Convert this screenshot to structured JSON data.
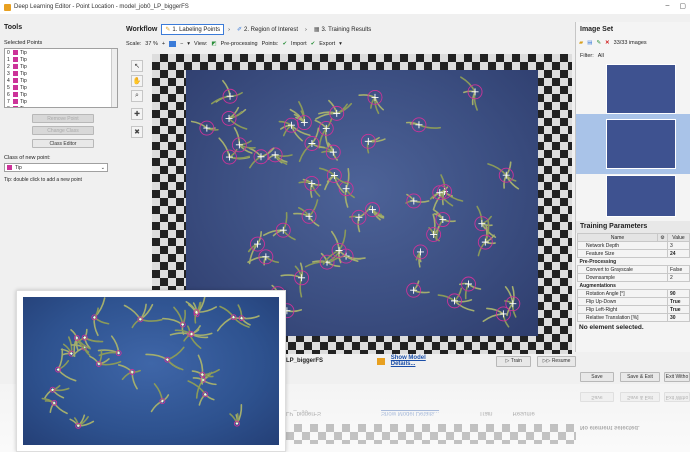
{
  "window": {
    "title": "Deep Learning Editor - Point Location - model_job0_LP_biggerFS",
    "minimize": "–",
    "maximize": "▢"
  },
  "tools": {
    "header": "Tools",
    "selected_points_label": "Selected Points",
    "points": [
      {
        "index": "0",
        "label": "Tip"
      },
      {
        "index": "1",
        "label": "Tip"
      },
      {
        "index": "2",
        "label": "Tip"
      },
      {
        "index": "3",
        "label": "Tip"
      },
      {
        "index": "4",
        "label": "Tip"
      },
      {
        "index": "5",
        "label": "Tip"
      },
      {
        "index": "6",
        "label": "Tip"
      },
      {
        "index": "7",
        "label": "Tip"
      },
      {
        "index": "8",
        "label": "Tip"
      }
    ],
    "remove_point": "Remove Point",
    "change_class": "Change Class",
    "class_editor": "Class Editor",
    "class_of_new_point_label": "Class of new point:",
    "class_selected": "Tip",
    "hint": "Tip: double click to add a new point"
  },
  "workflow": {
    "label": "Workflow",
    "steps": [
      {
        "label": "1. Labeling Points",
        "active": true
      },
      {
        "label": "2. Region of Interest",
        "active": false
      },
      {
        "label": "3. Training Results",
        "active": false
      }
    ]
  },
  "viewbar": {
    "scale_label": "Scale:",
    "scale_value": "37 %",
    "view_label": "View:",
    "view_value": "Pre-processing",
    "points_label": "Points:",
    "import_label": "Import",
    "export_label": "Export"
  },
  "image_set": {
    "header": "Image Set",
    "count": "33/33 images",
    "filter_label": "Filter:",
    "filter_value": "All"
  },
  "training": {
    "header": "Training Parameters",
    "col_name": "Name",
    "col_value": "Value",
    "rows": [
      {
        "name": "Network Depth",
        "value": "3",
        "bold": false
      },
      {
        "name": "Feature Size",
        "value": "24",
        "bold": true
      }
    ],
    "preproc_header": "Pre-Processing",
    "preproc_rows": [
      {
        "name": "Convert to Grayscale",
        "value": "False",
        "bold": false
      },
      {
        "name": "Downsample",
        "value": "2",
        "bold": false
      }
    ],
    "aug_header": "Augmentations",
    "aug_rows": [
      {
        "name": "Rotation Angle [°]",
        "value": "90",
        "bold": true
      },
      {
        "name": "Flip Up-Down",
        "value": "True",
        "bold": true
      },
      {
        "name": "Flip Left-Right",
        "value": "True",
        "bold": true
      },
      {
        "name": "Relative Translation [%]",
        "value": "30",
        "bold": true
      }
    ],
    "no_selection": "No element selected."
  },
  "bottom": {
    "model_name": "LP_biggerFS",
    "show_details": "Show Model Details...",
    "train": "Train",
    "resume": "Resume"
  },
  "dialog": {
    "save": "Save",
    "save_exit": "Save & Exit",
    "exit_without": "Exit Witho"
  },
  "colors": {
    "accent": "#3b7bd8",
    "point": "#cc3399",
    "cross": "#ffffff"
  }
}
